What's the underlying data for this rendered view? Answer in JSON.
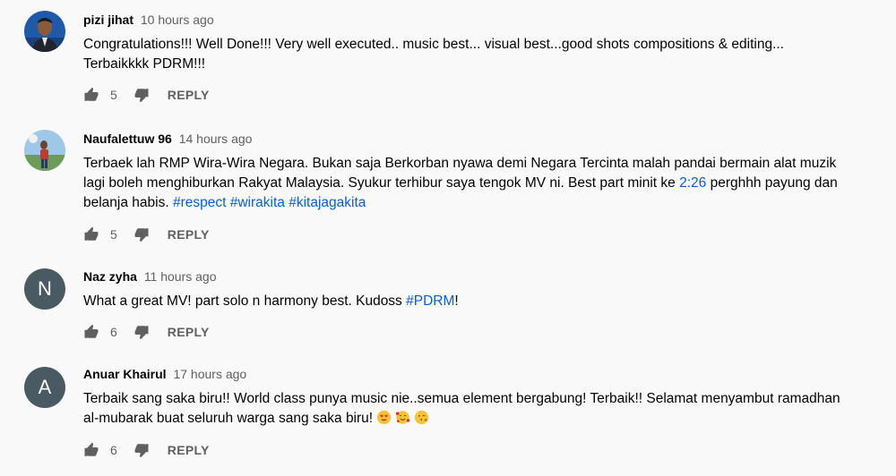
{
  "comments": [
    {
      "author": "pizi jihat",
      "time": "10 hours ago",
      "text1": "Congratulations!!! Well Done!!! Very well executed.. music best... visual best...good shots compositions & editing...",
      "text2": "Terbaikkkk PDRM!!!",
      "likes": "5",
      "reply_label": "REPLY"
    },
    {
      "author": "Naufalettuw 96",
      "time": "14 hours ago",
      "text1": "Terbaek lah RMP Wira-Wira Negara. Bukan saja Berkorban nyawa demi Negara Tercinta malah pandai bermain alat muzik",
      "text2_pre": "lagi boleh menghiburkan Rakyat Malaysia. Syukur terhibur saya tengok MV ni. Best part minit ke ",
      "timestamp_link": "2:26",
      "text2_post": " perghhh payung dan",
      "text3_pre": "belanja habis. ",
      "hashtags": [
        "#respect",
        "#wirakita",
        "#kitajagakita"
      ],
      "likes": "5",
      "reply_label": "REPLY"
    },
    {
      "author": "Naz zyha",
      "time": "11 hours ago",
      "avatar_letter": "N",
      "text_pre": "What a great MV! part solo n harmony best. Kudoss ",
      "hashtag": "#PDRM",
      "text_post": "!",
      "likes": "6",
      "reply_label": "REPLY"
    },
    {
      "author": "Anuar Khairul",
      "time": "17 hours ago",
      "avatar_letter": "A",
      "text1": "Terbaik sang saka biru!! World class punya music nie..semua element bergabung! Terbaik!! Selamat menyambut ramadhan",
      "text2": "al-mubarak buat seluruh warga sang saka biru! ",
      "emojis": [
        "heart-eyes-emoji",
        "smiling-hearts-emoji",
        "kissing-heart-emoji"
      ],
      "likes": "6",
      "reply_label": "REPLY"
    }
  ],
  "colors": {
    "link": "#065fd4",
    "secondary": "#606060",
    "avatar_bg": "#4a5a63"
  }
}
